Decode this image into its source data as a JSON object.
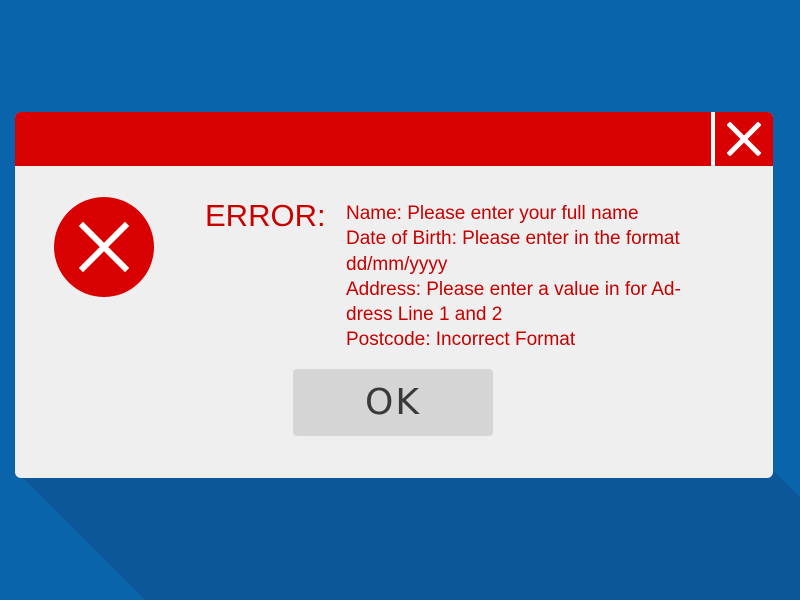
{
  "colors": {
    "background": "#0a64ac",
    "shadow": "#0b579a",
    "titlebar": "#d80000",
    "dialog": "#efefef",
    "error_text": "#c80000",
    "ok_button": "#d5d5d5"
  },
  "titlebar": {
    "close_icon": "close-icon"
  },
  "dialog": {
    "icon": "error-circle-x-icon",
    "heading": "ERROR:",
    "messages": [
      "Name: Please enter your full name",
      "Date of Birth: Please enter in the format",
      "dd/mm/yyyy",
      "Address: Please enter a value in for Ad-",
      "dress Line 1 and 2",
      "Postcode: Incorrect Format"
    ],
    "ok_label": "OK"
  }
}
